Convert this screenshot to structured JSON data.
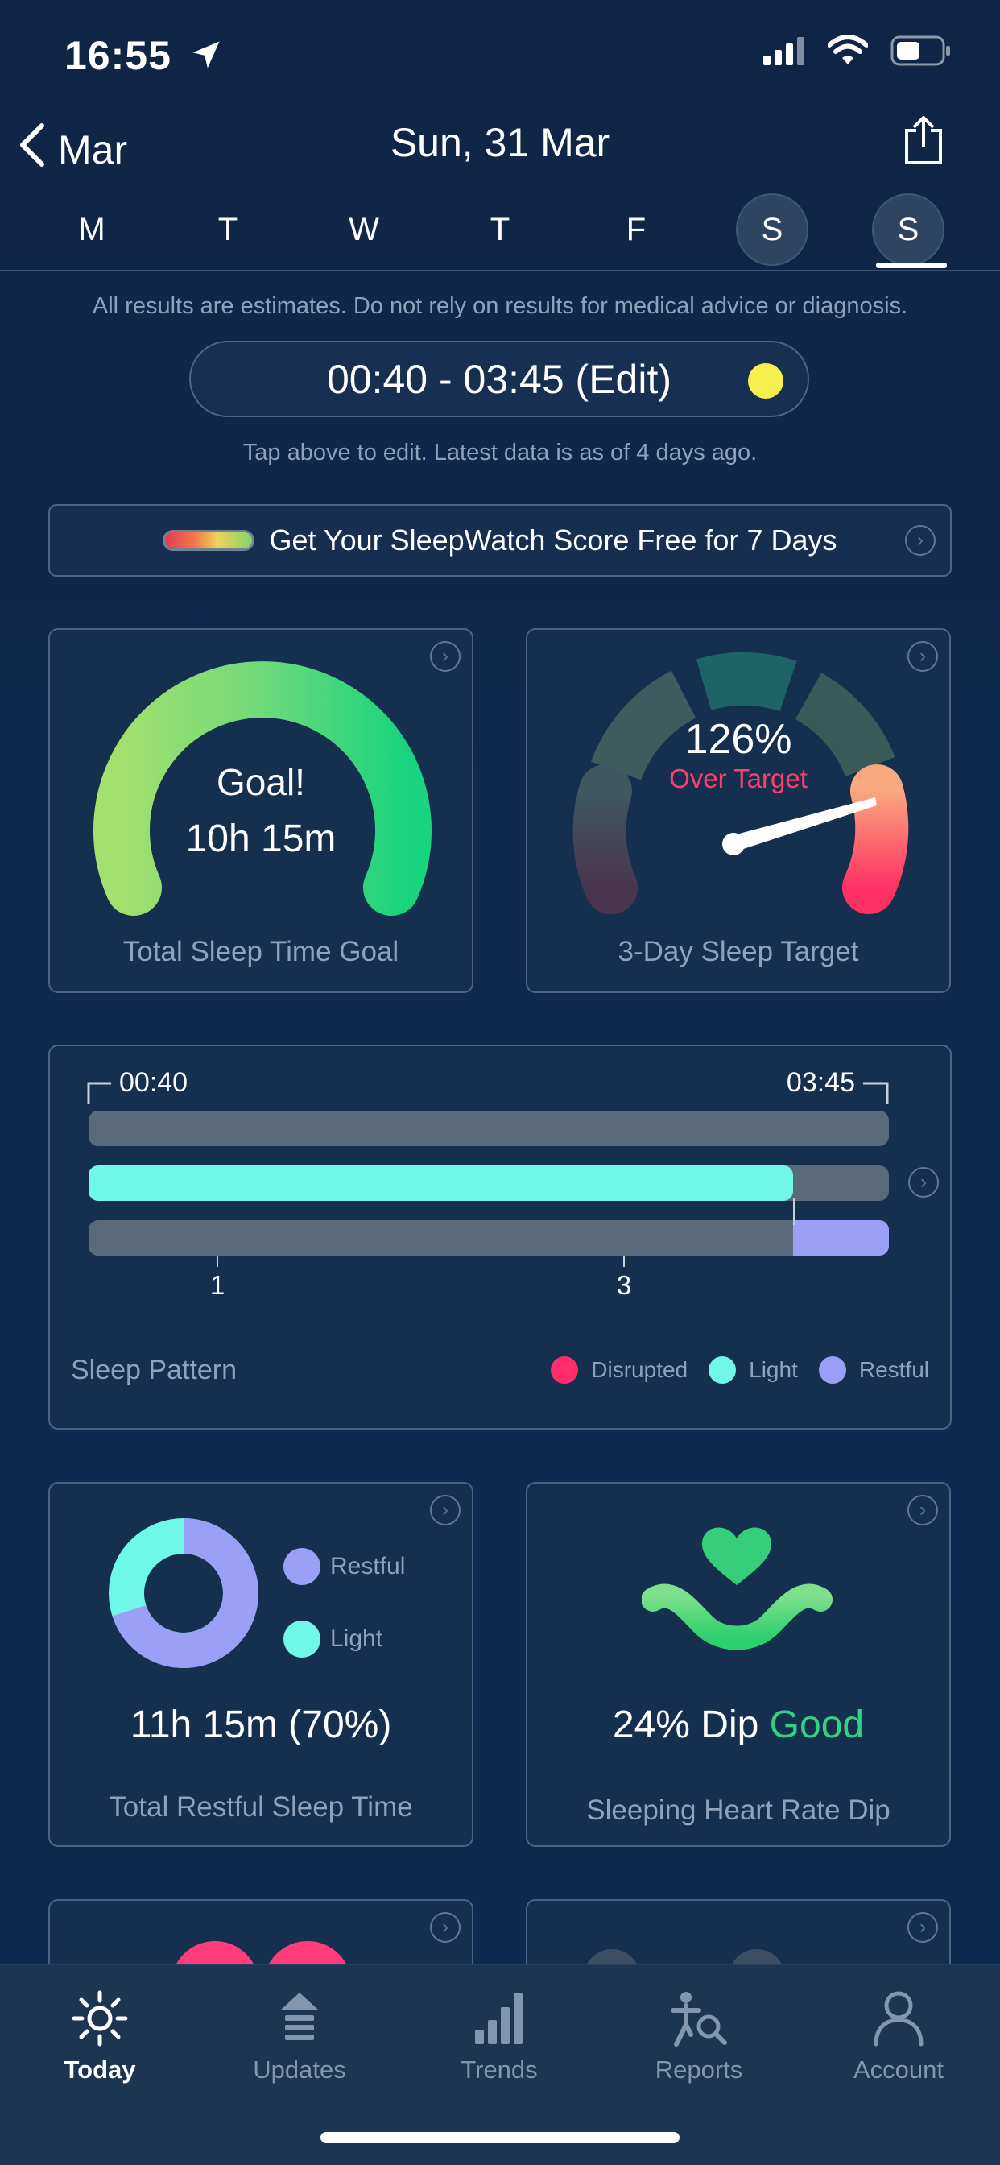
{
  "status": {
    "time": "16:55"
  },
  "header": {
    "back_label": "Mar",
    "date": "Sun, 31 Mar",
    "week_days": [
      "M",
      "T",
      "W",
      "T",
      "F",
      "S",
      "S"
    ]
  },
  "disclaimer": "All results are estimates. Do not rely on results for medical advice or diagnosis.",
  "time_pill": {
    "label": "00:40 - 03:45 (Edit)"
  },
  "tap_note": "Tap above to edit. Latest data is as of 4 days ago.",
  "promo": {
    "label": "Get Your SleepWatch Score Free for 7 Days"
  },
  "sleep_goal": {
    "line1": "Goal!",
    "line2": "10h 15m",
    "label": "Total Sleep Time Goal"
  },
  "sleep_target": {
    "percent": "126%",
    "status": "Over Target",
    "label": "3-Day Sleep Target"
  },
  "sleep_pattern": {
    "start": "00:40",
    "end": "03:45",
    "ticks": [
      "1",
      "3"
    ],
    "light_fraction": 0.88,
    "restful_fraction": 0.12,
    "label": "Sleep Pattern",
    "legend": [
      "Disrupted",
      "Light",
      "Restful"
    ]
  },
  "restful": {
    "legend": [
      "Restful",
      "Light"
    ],
    "value": "11h 15m (70%)",
    "restful_fraction": 0.7,
    "label": "Total Restful Sleep Time"
  },
  "heart_dip": {
    "value": "24% Dip",
    "rating": "Good",
    "label": "Sleeping Heart Rate Dip"
  },
  "colors": {
    "disrupted": "#ff2d6a",
    "light": "#6ff7e8",
    "restful": "#9aa0f6",
    "good": "#33d183"
  },
  "tabs": [
    {
      "label": "Today",
      "icon": "sun-icon"
    },
    {
      "label": "Updates",
      "icon": "updates-icon"
    },
    {
      "label": "Trends",
      "icon": "bar-chart-icon"
    },
    {
      "label": "Reports",
      "icon": "reports-icon"
    },
    {
      "label": "Account",
      "icon": "person-icon"
    }
  ]
}
